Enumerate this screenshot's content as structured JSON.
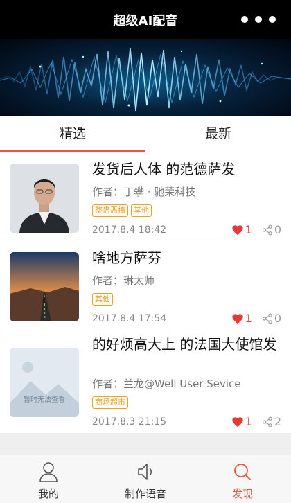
{
  "header": {
    "title": "超级AI配音",
    "more_icon": "more-dots-icon"
  },
  "tabs": [
    {
      "label": "精选",
      "active": true
    },
    {
      "label": "最新",
      "active": false
    }
  ],
  "items": [
    {
      "title": "发货后人体  的范德萨发",
      "author": "作者：丁攀 · 驰荣科技",
      "tags": [
        "整蛊恶搞",
        "其他"
      ],
      "date": "2017.8.4  18:42",
      "likes": "1",
      "shares": "0"
    },
    {
      "title": "啥地方萨芬",
      "author": "作者：琳太师",
      "tags": [
        "其他"
      ],
      "date": "2017.8.4  17:54",
      "likes": "1",
      "shares": "0"
    },
    {
      "title": "的好烦高大上  的法国大使馆发",
      "author": "作者：兰龙@Well User Sevice",
      "tags": [
        "商场超市"
      ],
      "date": "2017.8.3  21:15",
      "likes": "1",
      "shares": "2",
      "thumb_text": "暂时无法查看"
    }
  ],
  "tabbar": [
    {
      "label": "我的",
      "icon": "user-icon",
      "active": false
    },
    {
      "label": "制作语音",
      "icon": "speaker-icon",
      "active": false
    },
    {
      "label": "发现",
      "icon": "search-icon",
      "active": true
    }
  ],
  "colors": {
    "accent": "#e8573d",
    "tag": "#f0a020",
    "like": "#e53935"
  }
}
